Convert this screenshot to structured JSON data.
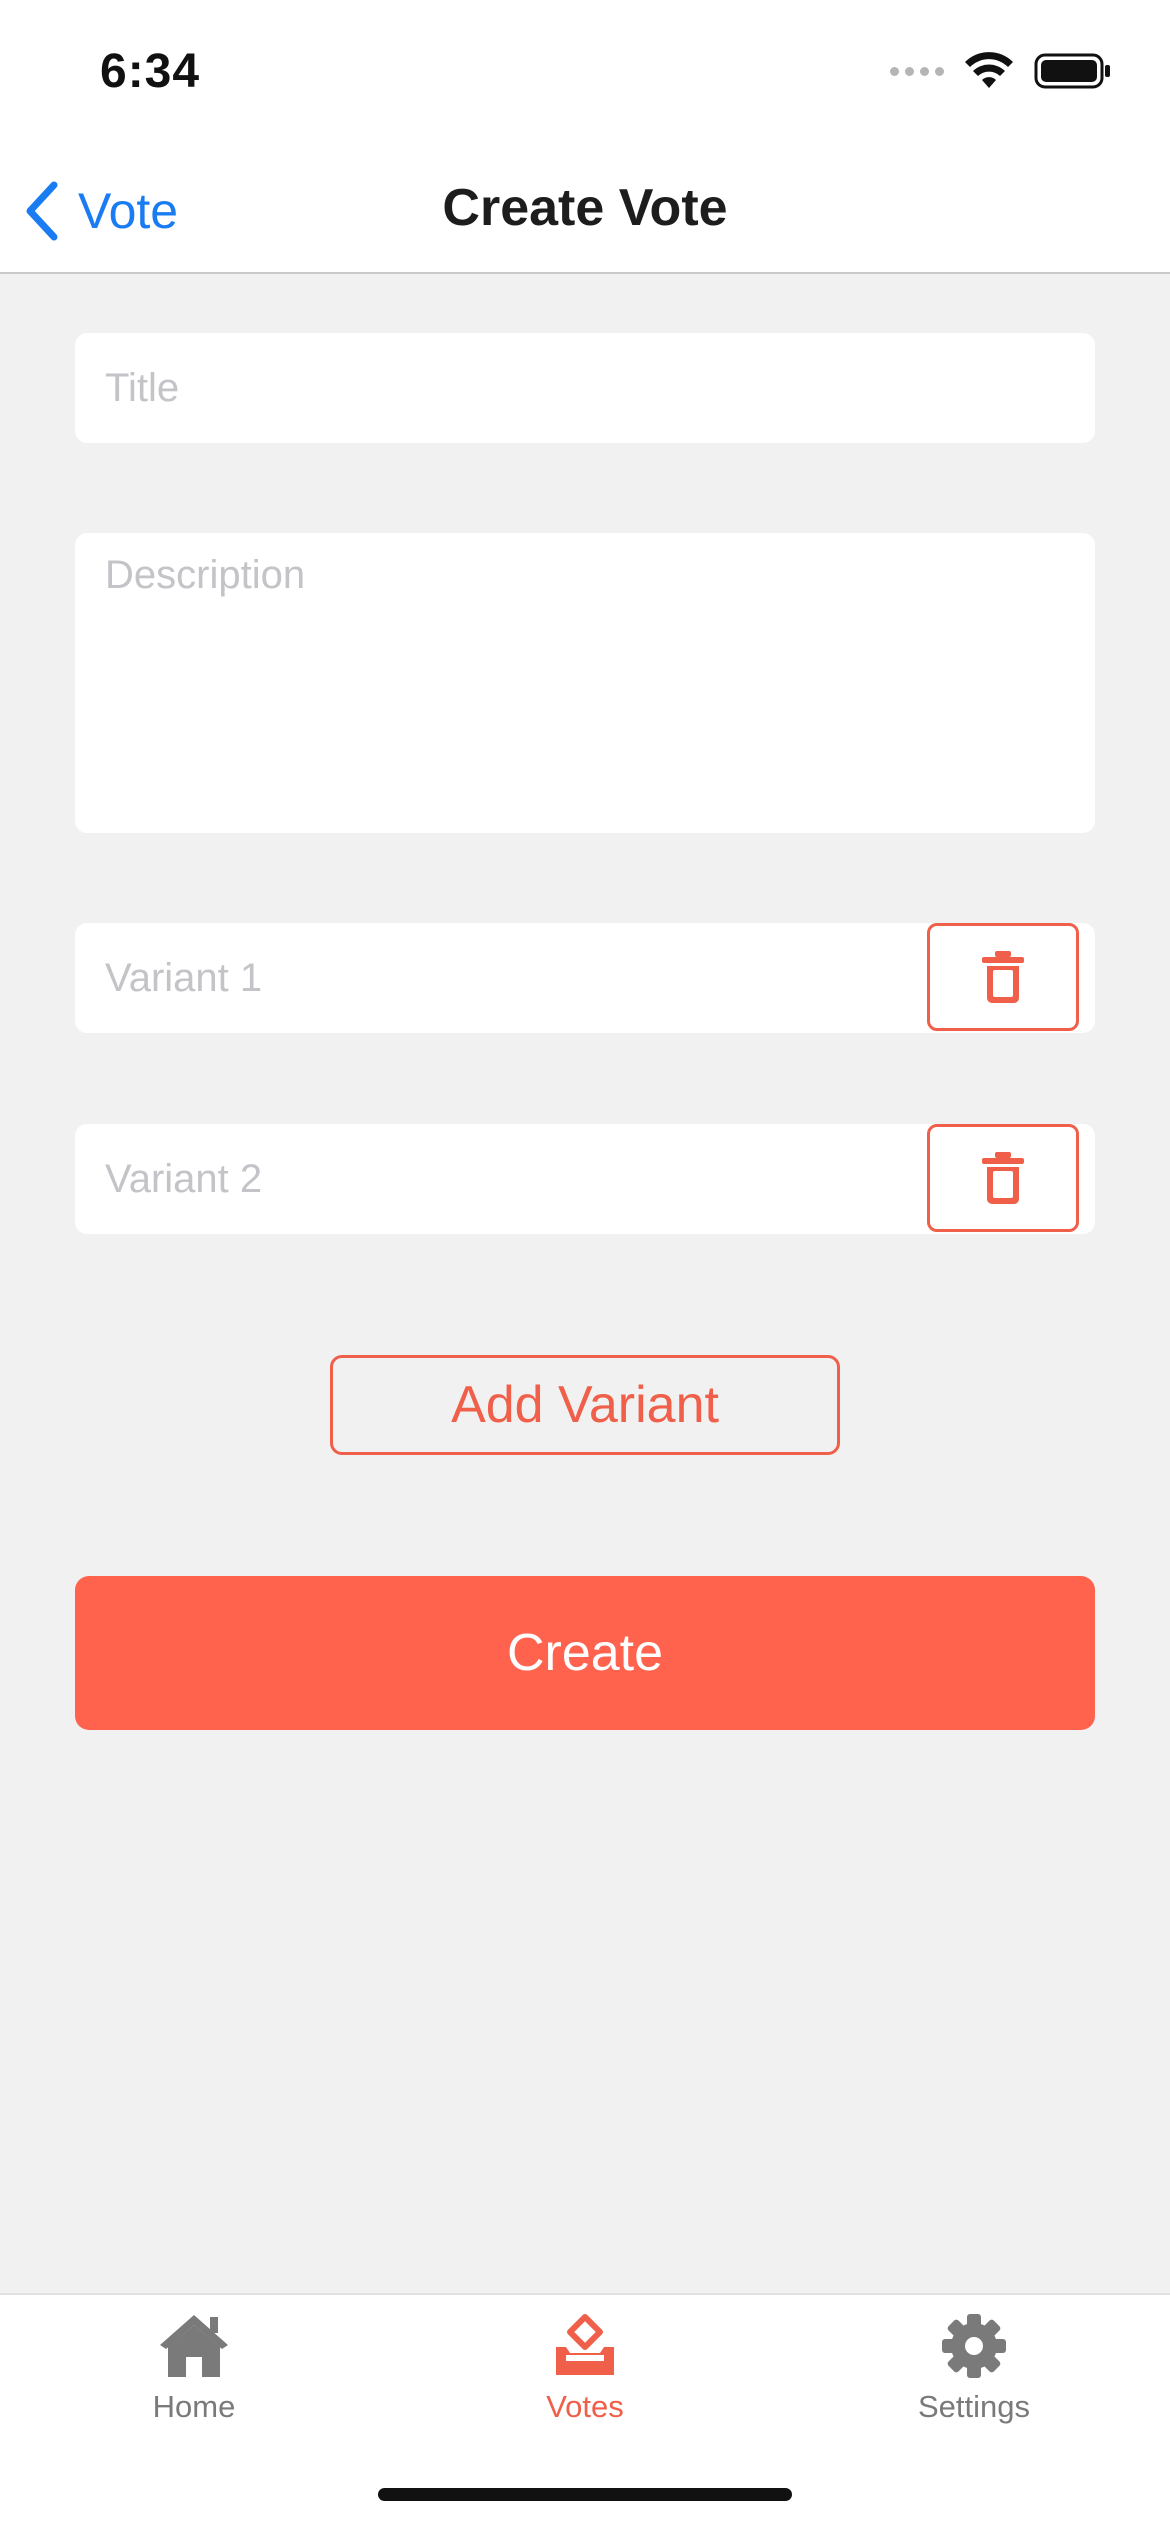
{
  "status_bar": {
    "time": "6:34"
  },
  "nav": {
    "back_label": "Vote",
    "title": "Create Vote"
  },
  "form": {
    "title_placeholder": "Title",
    "title_value": "",
    "description_placeholder": "Description",
    "description_value": "",
    "variants": [
      {
        "placeholder": "Variant 1",
        "value": ""
      },
      {
        "placeholder": "Variant 2",
        "value": ""
      }
    ],
    "add_variant_label": "Add Variant",
    "create_label": "Create"
  },
  "tabs": [
    {
      "label": "Home",
      "icon": "house-icon",
      "active": false
    },
    {
      "label": "Votes",
      "icon": "ballot-box-icon",
      "active": true
    },
    {
      "label": "Settings",
      "icon": "gear-icon",
      "active": false
    }
  ],
  "colors": {
    "accent": "#ff634e",
    "accent_outline": "#ef5f4a",
    "link_blue": "#1a7cf2",
    "background": "#f1f1f1",
    "tab_inactive": "#7a7a7a"
  }
}
